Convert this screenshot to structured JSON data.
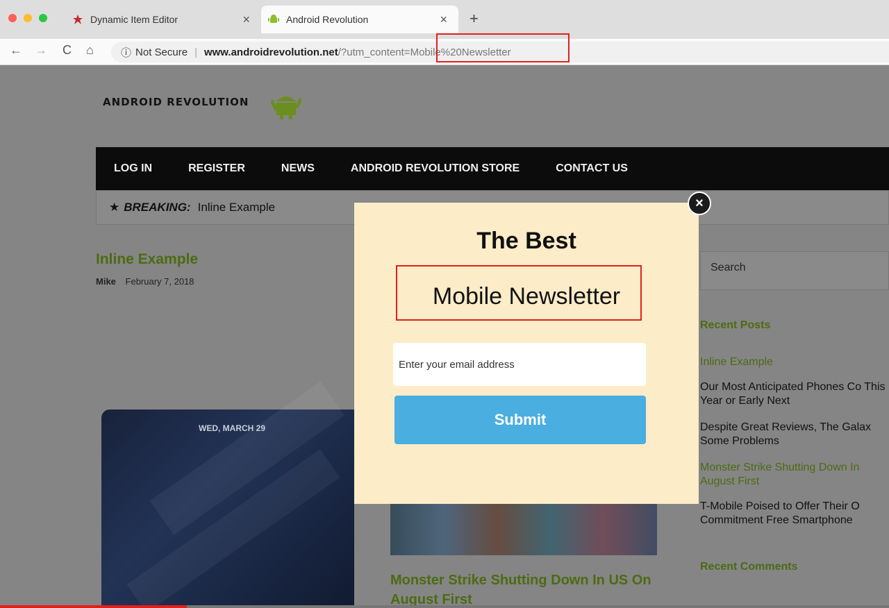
{
  "browser": {
    "tabs": [
      {
        "label": "Dynamic Item Editor",
        "active": false
      },
      {
        "label": "Android Revolution",
        "active": true
      }
    ],
    "new_tab": "+",
    "close_glyph": "×",
    "security": "Not Secure",
    "url_host": "www.androidrevolution.net",
    "url_path": "/?utm_content=",
    "url_param": "Mobile%20Newsletter",
    "nav": {
      "back": "←",
      "forward": "→",
      "reload": "C",
      "home": "⌂",
      "info": "ⓘ"
    }
  },
  "site": {
    "logo": "ANDROID REVOLUTION",
    "menu": [
      "LOG IN",
      "REGISTER",
      "NEWS",
      "ANDROID REVOLUTION STORE",
      "CONTACT US"
    ],
    "breaking_label": "BREAKING:",
    "breaking_text": "Inline Example",
    "post": {
      "title": "Inline Example",
      "author": "Mike",
      "date": "February 7, 2018"
    },
    "phone_date": "WED, MARCH 29",
    "article_title": "Monster Strike Shutting Down In US On August First",
    "sidebar": {
      "search_placeholder": "Search",
      "recent_posts_title": "Recent Posts",
      "recent_posts": [
        "Inline Example",
        "Our Most Anticipated Phones Co This Year or Early Next",
        "Despite Great Reviews, The Galax Some Problems",
        "Monster Strike Shutting Down In August First",
        "T-Mobile Poised to Offer Their O Commitment Free Smartphone"
      ],
      "recent_comments_title": "Recent Comments"
    }
  },
  "modal": {
    "heading": "The Best",
    "subheading": "Mobile Newsletter",
    "email_placeholder": "Enter your email address",
    "submit_label": "Submit",
    "close_glyph": "×"
  },
  "video": {
    "progress": 0.21
  },
  "colors": {
    "accent_red": "#e0201d",
    "submit_blue": "#4aaee0",
    "site_green": "#4c6b12",
    "modal_bg": "#fcecc8"
  }
}
